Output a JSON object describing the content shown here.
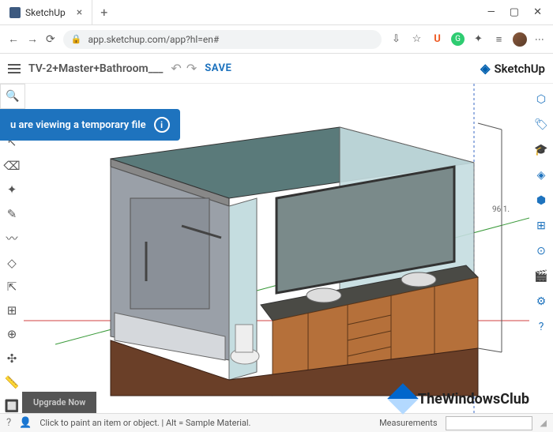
{
  "browser": {
    "tab_title": "SketchUp",
    "url": "app.sketchup.com/app?hl=en#"
  },
  "window_controls": {
    "min": "—",
    "max": "▢",
    "close": "✕"
  },
  "nav": {
    "back": "←",
    "fwd": "→",
    "reload": "⟳"
  },
  "header": {
    "filename": "TV-2+Master+Bathroom___",
    "save": "SAVE",
    "logo_text": "SketchUp"
  },
  "banner": {
    "text": "u are viewing a temporary file"
  },
  "upgrade": "Upgrade Now",
  "status": {
    "hint": "Click to paint an item or object. | Alt = Sample Material.",
    "measure_label": "Measurements"
  },
  "watermark": "TheWindowsClub",
  "dimension": "96 1.",
  "left_tools": [
    "↖",
    "⌫",
    "✦",
    "✎",
    "〰",
    "◇",
    "⇱",
    "⊞",
    "⊕",
    "✣",
    "📏",
    "🔲"
  ],
  "right_tools": [
    "⬡",
    "🏷",
    "🎓",
    "◈",
    "⬢",
    "⊞",
    "⊙",
    "🎬",
    "⚙",
    "?"
  ]
}
